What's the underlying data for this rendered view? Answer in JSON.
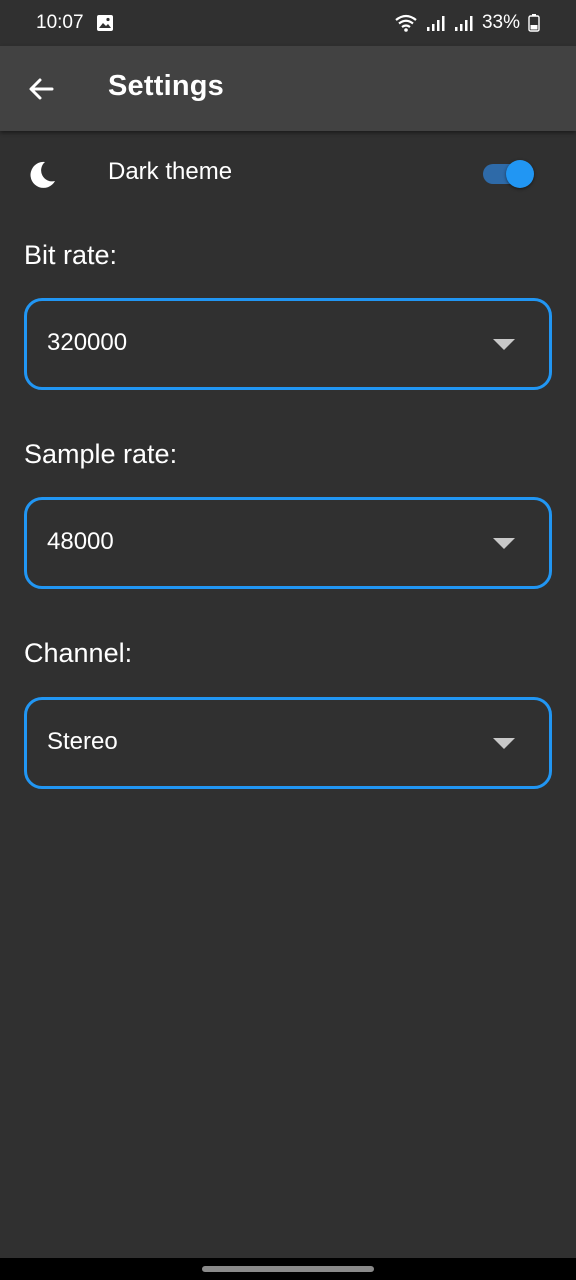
{
  "status_bar": {
    "time": "10:07",
    "battery": "33%",
    "icons": [
      "image-icon",
      "wifi-icon",
      "signal-icon",
      "signal-icon",
      "battery-icon"
    ]
  },
  "app_bar": {
    "title": "Settings",
    "back_icon": "arrow-back-icon"
  },
  "theme": {
    "label": "Dark theme",
    "icon": "moon-icon",
    "enabled": true,
    "accent": "#2196f3"
  },
  "bit_rate": {
    "label": "Bit rate:",
    "value": "320000"
  },
  "sample_rate": {
    "label": "Sample rate:",
    "value": "48000"
  },
  "channel": {
    "label": "Channel:",
    "value": "Stereo"
  },
  "colors": {
    "background": "#303030",
    "app_bar": "#424242",
    "accent": "#2196f3"
  }
}
